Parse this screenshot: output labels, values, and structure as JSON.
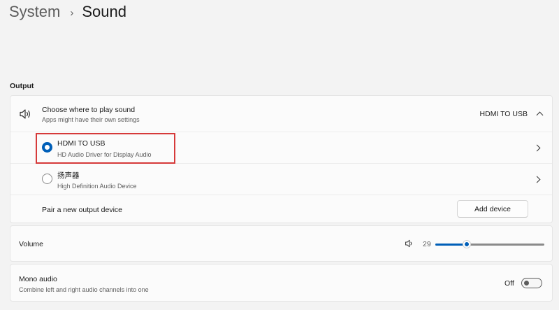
{
  "breadcrumb": {
    "parent": "System",
    "separator": "›",
    "current": "Sound"
  },
  "output": {
    "section_title": "Output",
    "choose": {
      "title": "Choose where to play sound",
      "subtitle": "Apps might have their own settings",
      "current_value": "HDMI TO USB",
      "icon": "speaker-icon"
    },
    "devices": [
      {
        "name": "HDMI TO USB",
        "driver": "HD Audio Driver for Display Audio",
        "selected": true
      },
      {
        "name": "扬声器",
        "driver": "High Definition Audio Device",
        "selected": false
      }
    ],
    "pair": {
      "label": "Pair a new output device",
      "button": "Add device"
    }
  },
  "volume": {
    "label": "Volume",
    "value": "29",
    "level": 29,
    "icon": "speaker-icon"
  },
  "mono": {
    "title": "Mono audio",
    "subtitle": "Combine left and right audio channels into one",
    "state": "Off",
    "on": false
  },
  "colors": {
    "accent": "#005fb8",
    "highlight": "#d63a3a"
  }
}
